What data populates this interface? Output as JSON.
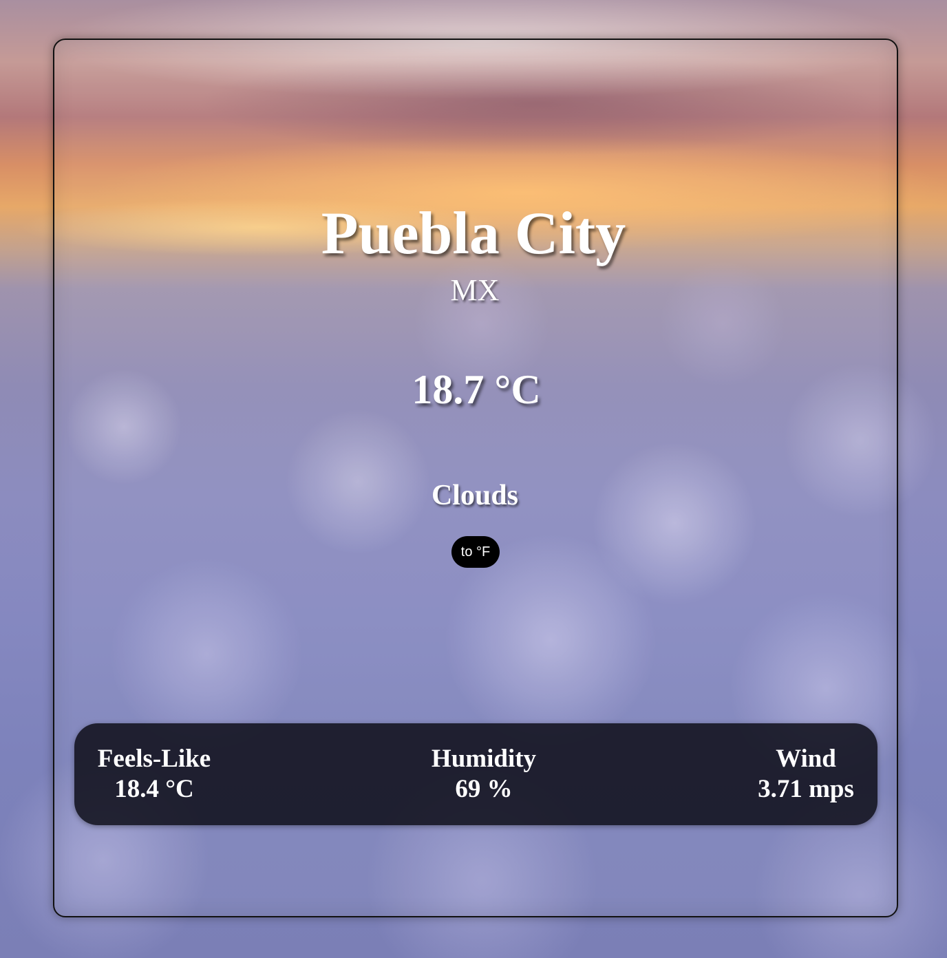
{
  "location": {
    "city": "Puebla City",
    "country": "MX"
  },
  "current": {
    "temperature": "18.7 °C",
    "condition": "Clouds"
  },
  "controls": {
    "unit_toggle_label": "to °F"
  },
  "details": {
    "feels_like": {
      "label": "Feels-Like",
      "value": "18.4 °C"
    },
    "humidity": {
      "label": "Humidity",
      "value": "69 %"
    },
    "wind": {
      "label": "Wind",
      "value": "3.71 mps"
    }
  },
  "colors": {
    "panel_background": "#0e0e18",
    "button_background": "#000000",
    "text": "#ffffff"
  }
}
